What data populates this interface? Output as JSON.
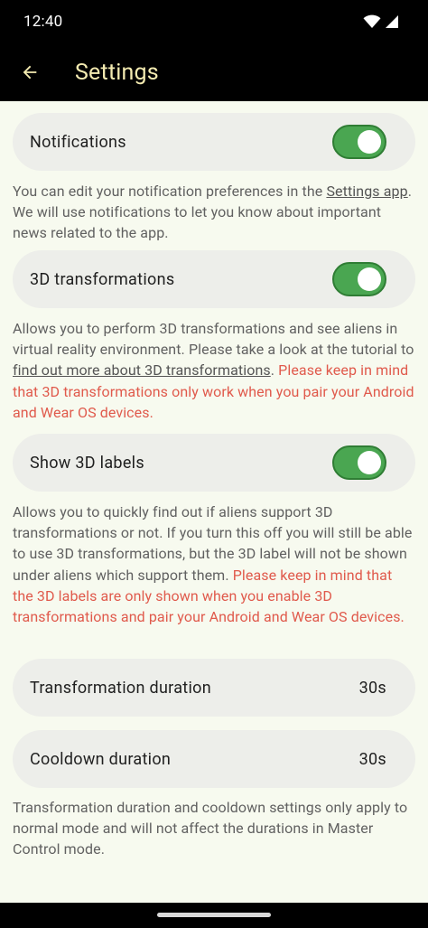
{
  "status": {
    "time": "12:40"
  },
  "app_bar": {
    "title": "Settings"
  },
  "notifications": {
    "label": "Notifications",
    "enabled": true,
    "desc_before": "You can edit your notification preferences in the ",
    "desc_link": "Settings app",
    "desc_after": ". We will use notifications to let you know about important news related to the app."
  },
  "transformations": {
    "label": "3D transformations",
    "enabled": true,
    "desc_before": "Allows you to perform 3D transformations and see aliens in virtual reality environment. Please take a look at the tutorial to ",
    "desc_link": "find out more about 3D transformations",
    "desc_after": ". ",
    "desc_warning": "Please keep in mind that 3D transformations only work when you pair your Android and Wear OS devices."
  },
  "labels": {
    "label": "Show 3D labels",
    "enabled": true,
    "desc": "Allows you to quickly find out if aliens support 3D transformations or not. If you turn this off you will still be able to use 3D transformations, but the 3D label will not be shown under aliens which support them. ",
    "desc_warning": "Please keep in mind that the 3D labels are only shown when you enable 3D transformations and pair your Android and Wear OS devices."
  },
  "transformation_duration": {
    "label": "Transformation duration",
    "value": "30s"
  },
  "cooldown_duration": {
    "label": "Cooldown duration",
    "value": "30s"
  },
  "durations_desc": "Transformation duration and cooldown settings only apply to normal mode and will not affect the durations in Master Control mode."
}
